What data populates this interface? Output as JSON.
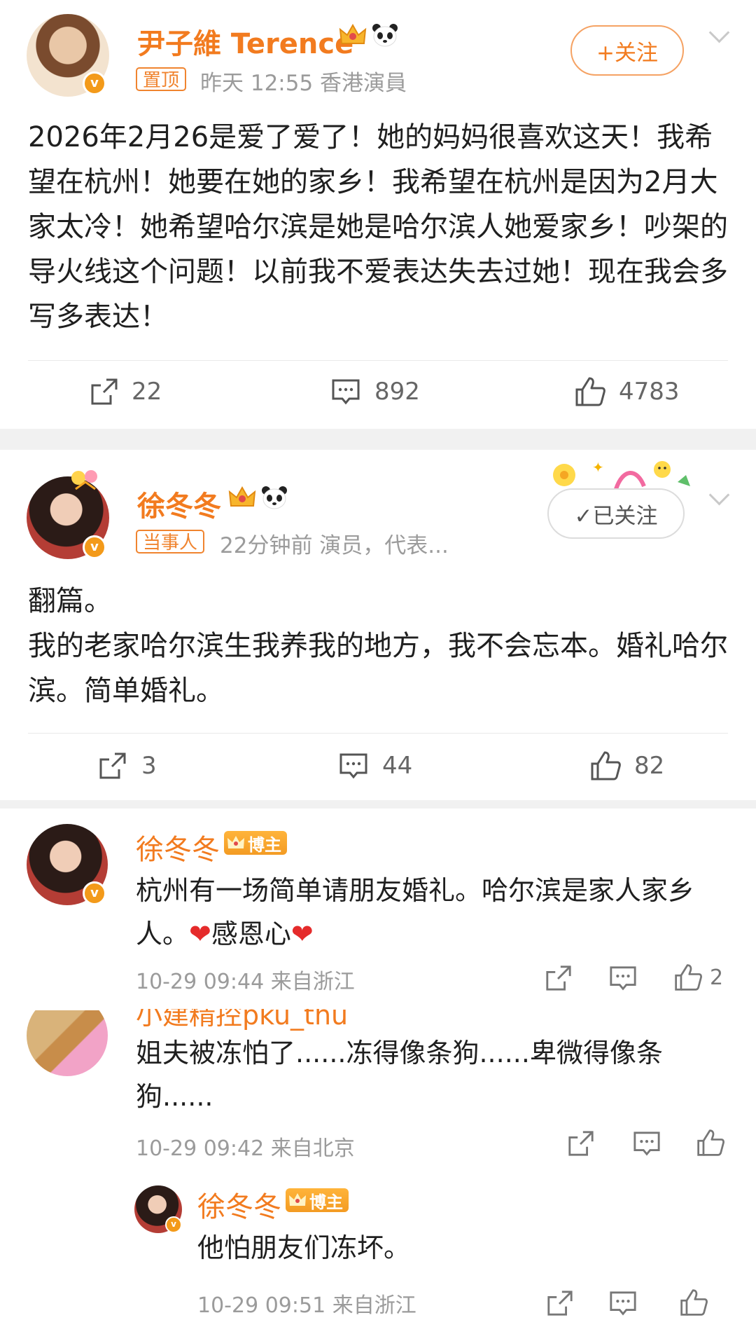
{
  "post1": {
    "author": "尹子維 Terence",
    "tag": "置顶",
    "meta": "昨天 12:55  香港演員",
    "follow_label": "+关注",
    "text": "2026年2月26是爱了爱了！她的妈妈很喜欢这天！我希望在杭州！她要在她的家乡！我希望在杭州是因为2月大家太冷！她希望哈尔滨是她是哈尔滨人她爱家乡！吵架的导火线这个问题！以前我不爱表达失去过她！现在我会多写多表达！",
    "reposts": "22",
    "comments": "892",
    "likes": "4783"
  },
  "post2": {
    "author": "徐冬冬",
    "tag": "当事人",
    "meta": "22分钟前  演员，代表...",
    "follow_label": "✓已关注",
    "text_line1": "翻篇。",
    "text_line2": "我的老家哈尔滨生我养我的地方，我不会忘本。婚礼哈尔滨。简单婚礼。",
    "reposts": "3",
    "comments": "44",
    "likes": "82"
  },
  "comments": [
    {
      "author": "徐冬冬",
      "badge": "博主",
      "text": "杭州有一场简单请朋友婚礼。哈尔滨是家人家乡人。",
      "text_heart_word": "感恩心",
      "time": "10-29 09:44  来自浙江",
      "likes": "2"
    },
    {
      "author": "小建精控pku_thu",
      "text": "姐夫被冻怕了......冻得像条狗......卑微得像条狗......",
      "time": "10-29 09:42  来自北京",
      "likes": ""
    },
    {
      "author": "徐冬冬",
      "badge": "博主",
      "text": "他怕朋友们冻坏。",
      "time": "10-29 09:51  来自浙江"
    }
  ],
  "colors": {
    "orange": "#f27b1f",
    "gray_text": "#9b9b9b",
    "divider": "#e9e9e9",
    "gap": "#f1f1f1"
  }
}
